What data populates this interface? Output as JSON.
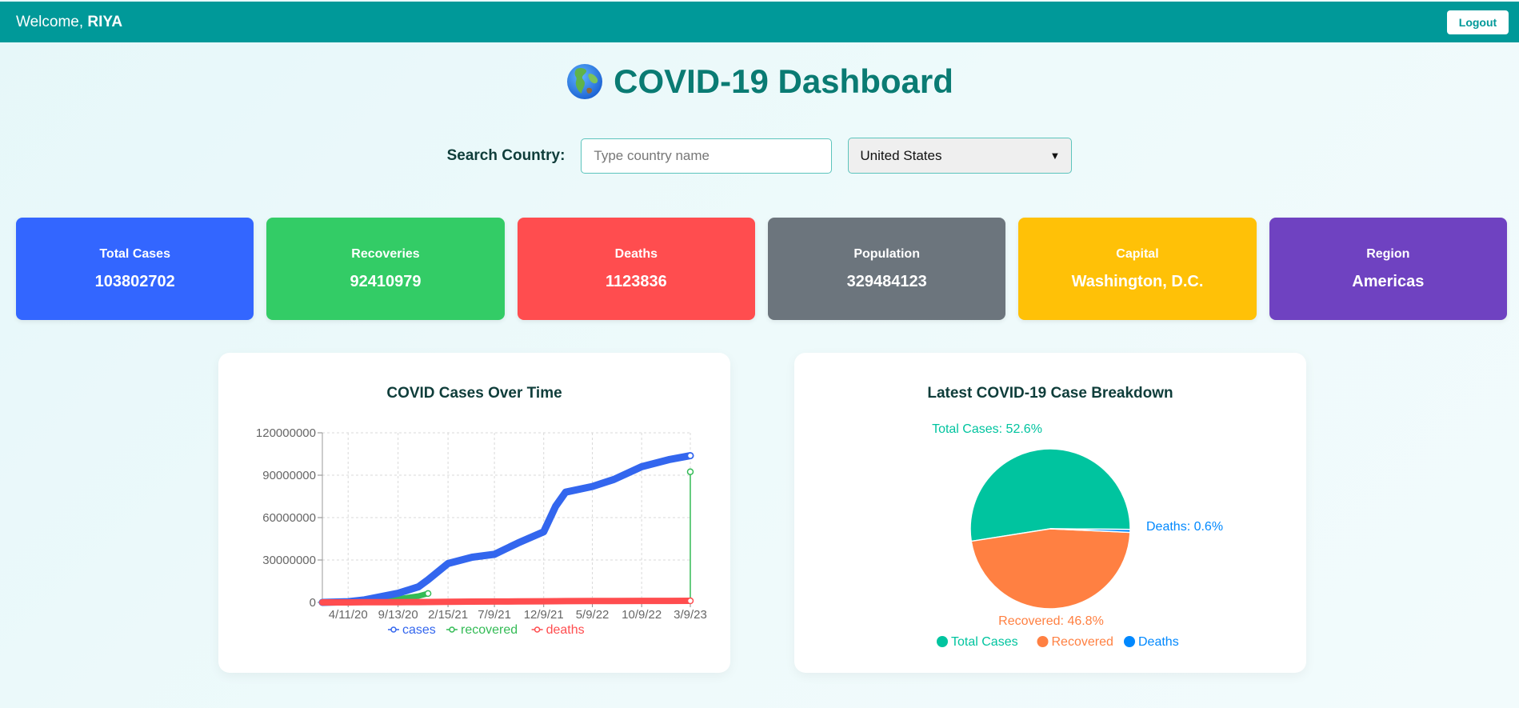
{
  "header": {
    "welcome_prefix": "Welcome, ",
    "username": "RIYA",
    "logout_label": "Logout"
  },
  "page": {
    "title": "COVID-19 Dashboard",
    "title_icon": "globe-icon"
  },
  "search": {
    "label": "Search Country:",
    "placeholder": "Type country name",
    "value": "",
    "selected_country": "United States"
  },
  "stats": [
    {
      "label": "Total Cases",
      "value": "103802702",
      "color": "#3366ff"
    },
    {
      "label": "Recoveries",
      "value": "92410979",
      "color": "#33cc66"
    },
    {
      "label": "Deaths",
      "value": "1123836",
      "color": "#ff4d4f"
    },
    {
      "label": "Population",
      "value": "329484123",
      "color": "#6c757d"
    },
    {
      "label": "Capital",
      "value": "Washington, D.C.",
      "color": "#ffc107"
    },
    {
      "label": "Region",
      "value": "Americas",
      "color": "#6f42c1"
    }
  ],
  "chart_data": [
    {
      "type": "line",
      "title": "COVID Cases Over Time",
      "xlabel": "",
      "ylabel": "",
      "ylim": [
        0,
        120000000
      ],
      "yticks": [
        "120000000",
        "90000000",
        "60000000",
        "30000000",
        "0"
      ],
      "xticks": [
        "4/11/20",
        "9/13/20",
        "2/15/21",
        "7/9/21",
        "12/9/21",
        "5/9/22",
        "10/9/22",
        "3/9/23"
      ],
      "grid": true,
      "legend": "bottom",
      "x": [
        "1/22/20",
        "4/11/20",
        "6/1/20",
        "9/13/20",
        "11/15/20",
        "12/15/20",
        "2/15/21",
        "5/1/21",
        "7/9/21",
        "9/20/21",
        "12/9/21",
        "1/15/22",
        "2/15/22",
        "5/9/22",
        "7/15/22",
        "10/9/22",
        "1/1/23",
        "3/9/23"
      ],
      "series": [
        {
          "name": "cases",
          "color": "#3366ee",
          "values": [
            0,
            500000,
            1800000,
            6500000,
            11000000,
            16000000,
            27500000,
            32000000,
            34000000,
            42000000,
            50000000,
            68000000,
            78000000,
            82000000,
            87000000,
            96000000,
            101000000,
            103802702
          ]
        },
        {
          "name": "recovered",
          "color": "#33bb55",
          "values": [
            0,
            70000,
            500000,
            2500000,
            4500000,
            6300000,
            null,
            null,
            null,
            null,
            null,
            null,
            null,
            null,
            null,
            null,
            null,
            92410979
          ]
        },
        {
          "name": "deaths",
          "color": "#ff4d4f",
          "values": [
            0,
            20000,
            100000,
            195000,
            250000,
            300000,
            480000,
            580000,
            610000,
            690000,
            800000,
            850000,
            930000,
            1000000,
            1020000,
            1060000,
            1100000,
            1123836
          ]
        }
      ]
    },
    {
      "type": "pie",
      "title": "Latest COVID-19 Case Breakdown",
      "legend": "bottom",
      "slices": [
        {
          "name": "Total Cases",
          "value": 52.6,
          "label": "Total Cases: 52.6%",
          "color": "#00c49f"
        },
        {
          "name": "Recovered",
          "value": 46.8,
          "label": "Recovered: 46.8%",
          "color": "#ff8042"
        },
        {
          "name": "Deaths",
          "value": 0.6,
          "label": "Deaths: 0.6%",
          "color": "#0088fe"
        }
      ]
    }
  ]
}
